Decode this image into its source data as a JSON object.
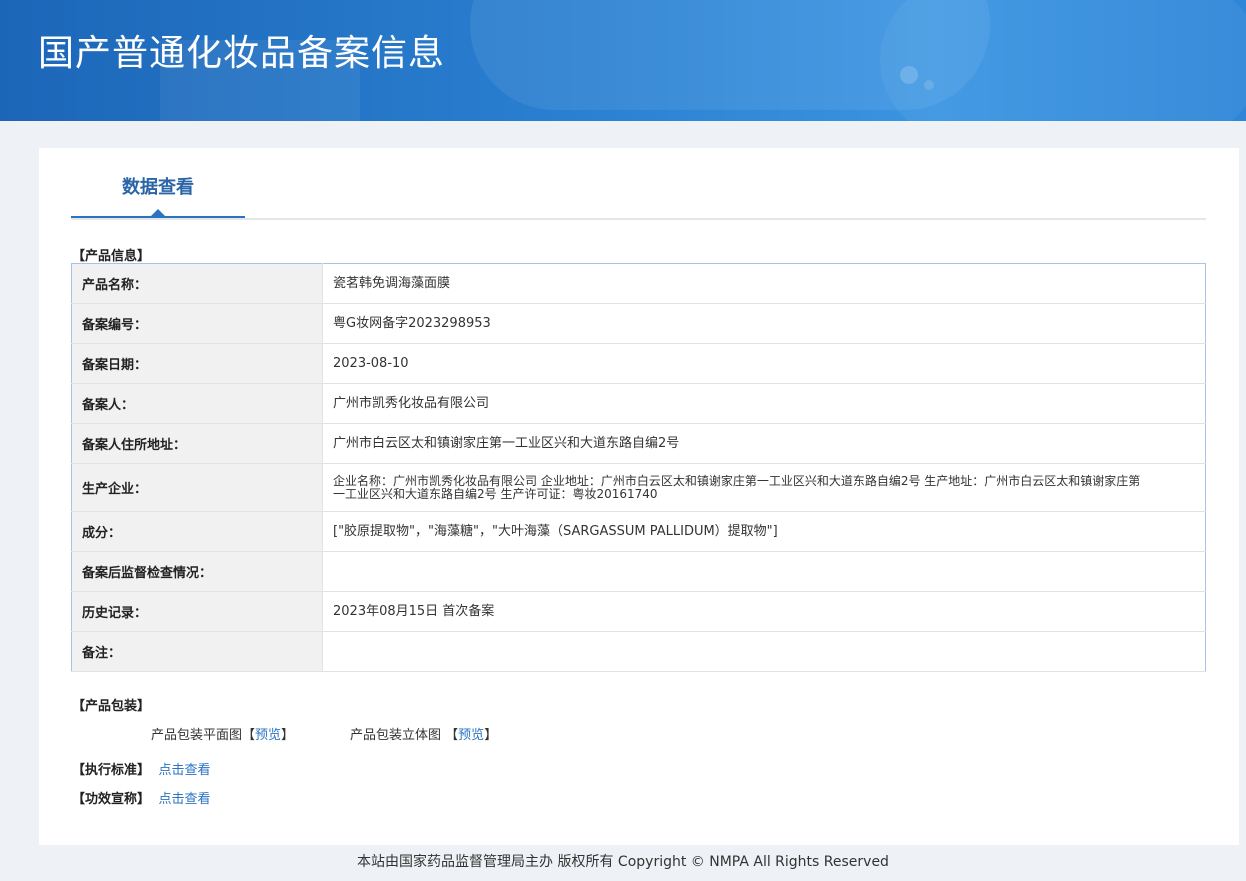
{
  "header": {
    "title": "国产普通化妆品备案信息"
  },
  "tabs": {
    "active_label": "数据查看"
  },
  "product_info": {
    "section_title": "【产品信息】",
    "rows": [
      {
        "label": "产品名称：",
        "value": "瓷茗韩免调海藻面膜"
      },
      {
        "label": "备案编号：",
        "value": "粤G妆网备字2023298953"
      },
      {
        "label": "备案日期：",
        "value": "2023-08-10"
      },
      {
        "label": "备案人：",
        "value": "广州市凯秀化妆品有限公司"
      },
      {
        "label": "备案人住所地址：",
        "value": "广州市白云区太和镇谢家庄第一工业区兴和大道东路自编2号"
      },
      {
        "label": "生产企业：",
        "value": "企业名称：广州市凯秀化妆品有限公司 企业地址：广州市白云区太和镇谢家庄第一工业区兴和大道东路自编2号 生产地址：广州市白云区太和镇谢家庄第一工业区兴和大道东路自编2号 生产许可证：粤妆20161740"
      },
      {
        "label": "成分：",
        "value": "[\"胶原提取物\"，\"海藻糖\"，\"大叶海藻（SARGASSUM PALLIDUM）提取物\"]"
      },
      {
        "label": "备案后监督检查情况：",
        "value": ""
      },
      {
        "label": "历史记录：",
        "value": "2023年08月15日 首次备案"
      },
      {
        "label": "备注：",
        "value": ""
      }
    ]
  },
  "packaging": {
    "section_title": "【产品包装】",
    "flat_label": "产品包装平面图",
    "flat_open": "【",
    "flat_link": "预览",
    "flat_close": "】",
    "solid_label": "产品包装立体图",
    "solid_open": "【",
    "solid_link": "预览",
    "solid_close": "】"
  },
  "standard": {
    "section_title": "【执行标准】",
    "link": "点击查看"
  },
  "efficacy": {
    "section_title": "【功效宣称】",
    "link": "点击查看"
  },
  "footer": {
    "text": "本站由国家药品监督管理局主办 版权所有 Copyright © NMPA All Rights Reserved"
  },
  "colors": {
    "banner": "#2a7fd0",
    "accent": "#2a73c3",
    "link": "#2a73c3"
  }
}
